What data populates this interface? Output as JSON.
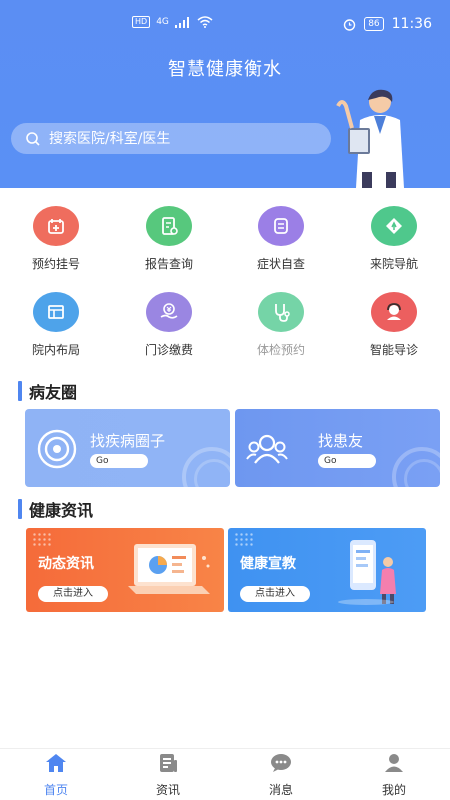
{
  "status_bar": {
    "left_chip": "HD",
    "signal_text": "4G",
    "battery": "86",
    "time": "11:36"
  },
  "header": {
    "title": "智慧健康衡水",
    "search_placeholder": "搜索医院/科室/医生"
  },
  "services": [
    {
      "label": "预约挂号",
      "icon": "register-icon",
      "color": "#ef6d5e"
    },
    {
      "label": "报告查询",
      "icon": "report-icon",
      "color": "#57c87d"
    },
    {
      "label": "症状自查",
      "icon": "symptom-icon",
      "color": "#9b7fe6"
    },
    {
      "label": "来院导航",
      "icon": "navigation-icon",
      "color": "#4fc88c"
    },
    {
      "label": "院内布局",
      "icon": "layout-icon",
      "color": "#4ea3ea"
    },
    {
      "label": "门诊缴费",
      "icon": "payment-icon",
      "color": "#9a86e2"
    },
    {
      "label": "体检预约",
      "icon": "checkup-icon",
      "color": "#75d4a7"
    },
    {
      "label": "智能导诊",
      "icon": "guide-icon",
      "color": "#ec5f5f"
    }
  ],
  "circle_section": {
    "title": "病友圈",
    "cards": [
      {
        "title": "找疾病圈子",
        "button": "Go",
        "icon": "circle-icon"
      },
      {
        "title": "找患友",
        "button": "Go",
        "icon": "people-icon"
      }
    ]
  },
  "news_section": {
    "title": "健康资讯",
    "cards": [
      {
        "title": "动态资讯",
        "button": "点击进入"
      },
      {
        "title": "健康宣教",
        "button": "点击进入"
      }
    ]
  },
  "tabbar": {
    "active": 0,
    "tabs": [
      {
        "label": "首页",
        "icon": "home-icon"
      },
      {
        "label": "资讯",
        "icon": "news-icon"
      },
      {
        "label": "消息",
        "icon": "message-icon"
      },
      {
        "label": "我的",
        "icon": "profile-icon"
      }
    ]
  },
  "colors": {
    "primary": "#5b8ef3",
    "accent_orange": "#f56b3a",
    "accent_blue": "#3f92f1"
  }
}
